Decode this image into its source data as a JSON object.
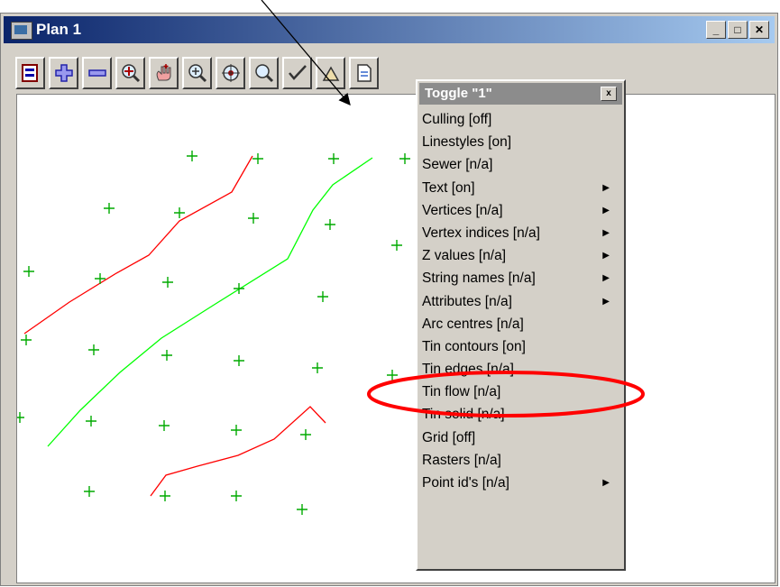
{
  "window": {
    "title": "Plan 1",
    "icon": "app-icon"
  },
  "window_controls": [
    "minimize-icon",
    "maximize-icon",
    "close-icon"
  ],
  "toolbar": {
    "buttons": [
      "plot-icon",
      "zoom-in-icon",
      "zoom-out-icon",
      "pan-icon",
      "hand-pan-icon",
      "zoom-icon",
      "target-icon",
      "magnify-icon",
      "toggle-icon",
      "options-icon",
      "document-icon"
    ]
  },
  "menu": {
    "title": "Toggle \"1\"",
    "close_label": "x",
    "items": [
      {
        "label": "Culling [off]",
        "submenu": false
      },
      {
        "label": "Linestyles [on]",
        "submenu": false
      },
      {
        "label": "Sewer [n/a]",
        "submenu": false
      },
      {
        "label": "Text [on]",
        "submenu": true
      },
      {
        "label": "Vertices [n/a]",
        "submenu": true
      },
      {
        "label": "Vertex indices [n/a]",
        "submenu": true
      },
      {
        "label": "Z values [n/a]",
        "submenu": true
      },
      {
        "label": "String names [n/a]",
        "submenu": true
      },
      {
        "label": "Attributes [n/a]",
        "submenu": true
      },
      {
        "label": "Arc centres [n/a]",
        "submenu": false
      },
      {
        "label": "Tin contours [on]",
        "submenu": false
      },
      {
        "label": "Tin edges [n/a]",
        "submenu": false
      },
      {
        "label": "Tin flow [n/a]",
        "submenu": false
      },
      {
        "label": "Tin solid [n/a]",
        "submenu": false
      },
      {
        "label": "Grid [off]",
        "submenu": false
      },
      {
        "label": "Rasters [n/a]",
        "submenu": false
      },
      {
        "label": "Point id's [n/a]",
        "submenu": true
      }
    ]
  },
  "colors": {
    "contour_red": "#ff0000",
    "contour_green": "#00ff00",
    "point_green": "#00aa00",
    "highlight_ellipse": "#ff0000",
    "annotation_arrow": "#000000"
  }
}
